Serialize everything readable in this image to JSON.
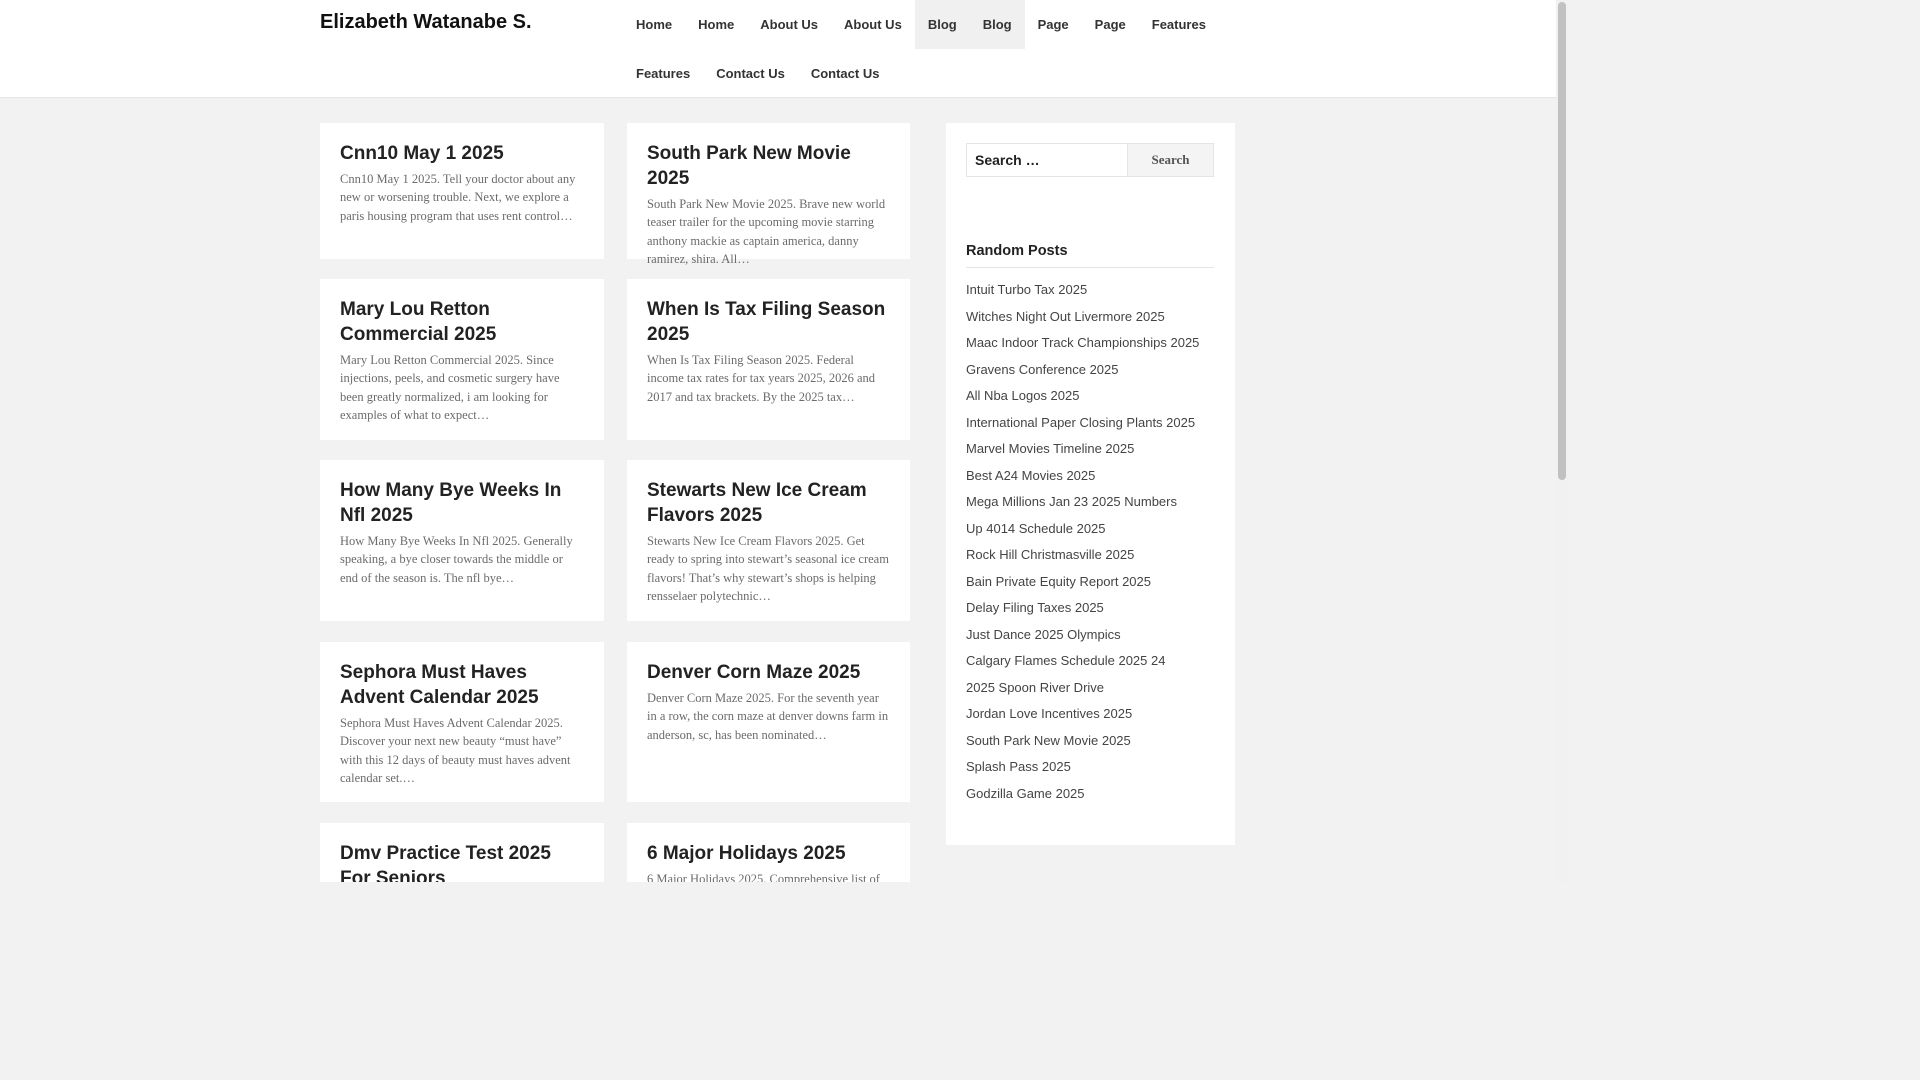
{
  "site": {
    "title": "Elizabeth Watanabe S."
  },
  "nav": {
    "row1": [
      "Home",
      "Home",
      "About Us",
      "About Us",
      "Blog",
      "Blog",
      "Page",
      "Page",
      "Features"
    ],
    "row2": [
      "Features",
      "Contact Us",
      "Contact Us"
    ]
  },
  "posts": [
    {
      "title": "Cnn10 May 1 2025",
      "excerpt": "Cnn10 May 1 2025. Tell your doctor about any new or worsening trouble. Next, we explore a paris housing program that uses rent control…"
    },
    {
      "title": "South Park New Movie 2025",
      "excerpt": "South Park New Movie 2025. Brave new world teaser trailer for the upcoming movie starring anthony mackie as captain america, danny ramirez, shira. All…"
    },
    {
      "title": "Mary Lou Retton Commercial 2025",
      "excerpt": "Mary Lou Retton Commercial 2025. Since injections, peels, and cosmetic surgery have been greatly normalized, i am looking for examples of what to expect…"
    },
    {
      "title": "When Is Tax Filing Season 2025",
      "excerpt": "When Is Tax Filing Season 2025. Federal income tax rates for tax years 2025, 2026 and 2017 and tax brackets. By the 2025 tax…"
    },
    {
      "title": "How Many Bye Weeks In Nfl 2025",
      "excerpt": "How Many Bye Weeks In Nfl 2025. Generally speaking, a bye closer towards the middle or end of the season is. The nfl bye…"
    },
    {
      "title": "Stewarts New Ice Cream Flavors 2025",
      "excerpt": "Stewarts New Ice Cream Flavors 2025. Get ready to spring into stewart’s seasonal ice cream flavors! That’s why stewart’s shops is helping rensselaer polytechnic…"
    },
    {
      "title": "Sephora Must Haves Advent Calendar 2025",
      "excerpt": "Sephora Must Haves Advent Calendar 2025. Discover your next new beauty “must have” with this 12 days of beauty must haves advent calendar set.…"
    },
    {
      "title": "Denver Corn Maze 2025",
      "excerpt": "Denver Corn Maze 2025. For the seventh year in a row, the corn maze at denver downs farm in anderson, sc, has been nominated…"
    },
    {
      "title": "Dmv Practice Test 2025 For Seniors",
      "excerpt": ""
    },
    {
      "title": "6 Major Holidays 2025",
      "excerpt": "6 Major Holidays 2025. Comprehensive list of"
    }
  ],
  "sidebar": {
    "search_placeholder": "Search …",
    "search_button": "Search",
    "random_title": "Random Posts",
    "random_posts": [
      "Intuit Turbo Tax 2025",
      "Witches Night Out Livermore 2025",
      "Maac Indoor Track Championships 2025",
      "Gravens Conference 2025",
      "All Nba Logos 2025",
      "International Paper Closing Plants 2025",
      "Marvel Movies Timeline 2025",
      "Best A24 Movies 2025",
      "Mega Millions Jan 23 2025 Numbers",
      "Up 4014 Schedule 2025",
      "Rock Hill Christmasville 2025",
      "Bain Private Equity Report 2025",
      "Delay Filing Taxes 2025",
      "Just Dance 2025 Olympics",
      "Calgary Flames Schedule 2025 24",
      "2025 Spoon River Drive",
      "Jordan Love Incentives 2025",
      "South Park New Movie 2025",
      "Splash Pass 2025",
      "Godzilla Game 2025"
    ]
  }
}
